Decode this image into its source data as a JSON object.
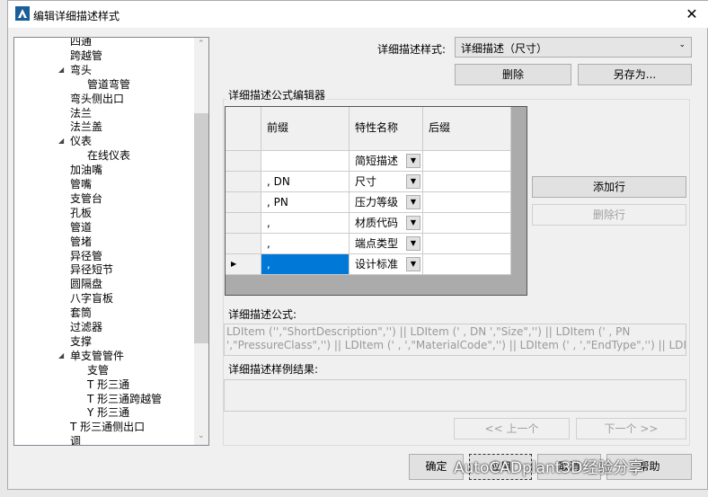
{
  "window": {
    "title": "编辑详细描述样式",
    "close_icon": "close-icon"
  },
  "tree": {
    "items": [
      {
        "label": "四通",
        "level": 1
      },
      {
        "label": "跨越管",
        "level": 1
      },
      {
        "label": "弯头",
        "level": 1,
        "expanded": true
      },
      {
        "label": "管道弯管",
        "level": 2
      },
      {
        "label": "弯头侧出口",
        "level": 1
      },
      {
        "label": "法兰",
        "level": 1
      },
      {
        "label": "法兰盖",
        "level": 1
      },
      {
        "label": "仪表",
        "level": 1,
        "expanded": true
      },
      {
        "label": "在线仪表",
        "level": 2
      },
      {
        "label": "加油嘴",
        "level": 1
      },
      {
        "label": "管嘴",
        "level": 1
      },
      {
        "label": "支管台",
        "level": 1
      },
      {
        "label": "孔板",
        "level": 1
      },
      {
        "label": "管道",
        "level": 1
      },
      {
        "label": "管堵",
        "level": 1
      },
      {
        "label": "异径管",
        "level": 1
      },
      {
        "label": "异径短节",
        "level": 1
      },
      {
        "label": "圆隔盘",
        "level": 1
      },
      {
        "label": "八字盲板",
        "level": 1
      },
      {
        "label": "套筒",
        "level": 1
      },
      {
        "label": "过滤器",
        "level": 1
      },
      {
        "label": "支撑",
        "level": 1
      },
      {
        "label": "单支管管件",
        "level": 1,
        "expanded": true
      },
      {
        "label": "支管",
        "level": 2
      },
      {
        "label": "T 形三通",
        "level": 2
      },
      {
        "label": "T 形三通跨越管",
        "level": 2
      },
      {
        "label": "Y 形三通",
        "level": 2
      },
      {
        "label": "T 形三通侧出口",
        "level": 1
      },
      {
        "label": "调",
        "level": 1
      }
    ]
  },
  "style": {
    "label": "详细描述样式:",
    "value": "详细描述（尺寸）",
    "delete": "删除",
    "save_as": "另存为..."
  },
  "editor": {
    "group_label": "详细描述公式编辑器",
    "columns": [
      "前缀",
      "特性名称",
      "后缀"
    ],
    "rows": [
      {
        "prefix": "",
        "property": "简短描述",
        "suffix": ""
      },
      {
        "prefix": ", DN",
        "property": "尺寸",
        "suffix": ""
      },
      {
        "prefix": ", PN",
        "property": "压力等级",
        "suffix": ""
      },
      {
        "prefix": ",",
        "property": "材质代码",
        "suffix": ""
      },
      {
        "prefix": ",",
        "property": "端点类型",
        "suffix": ""
      },
      {
        "prefix": ",",
        "property": "设计标准",
        "suffix": "",
        "selected": true
      }
    ],
    "add_row": "添加行",
    "delete_row": "删除行",
    "formula_label": "详细描述公式:",
    "formula_line1": "LDItem ('',\"ShortDescription\",'') || LDItem (' , DN ',\"Size\",'') || LDItem (' , PN",
    "formula_line2": "',\"PressureClass\",'') || LDItem (' , ',\"MaterialCode\",'') || LDItem (' , ',\"EndType\",'') || LDItem...",
    "sample_label": "详细描述样例结果:",
    "sample_value": "",
    "prev": "<< 上一个",
    "next": "下一个 >>"
  },
  "footer": {
    "ok": "确定",
    "apply": "应用",
    "cancel": "取消",
    "help": "帮助"
  },
  "watermark": "AutoCADplant3D经验分享",
  "colors": {
    "selection": "#0078d7"
  }
}
